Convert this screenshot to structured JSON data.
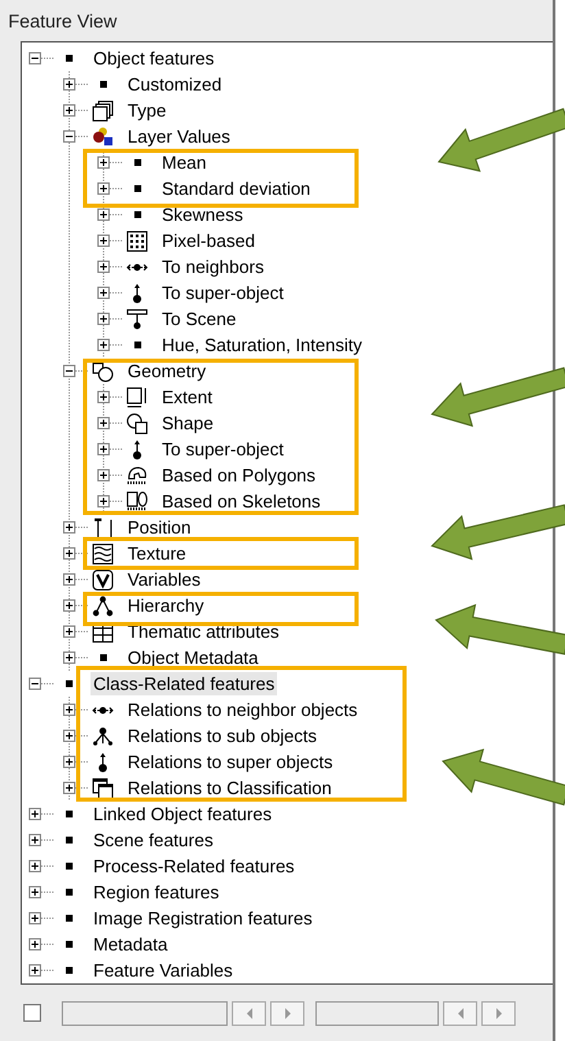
{
  "window": {
    "title": "Feature View"
  },
  "footer": {
    "checkbox": {
      "checked": false
    }
  },
  "tree": [
    {
      "label": "Object features",
      "kind": "bullet",
      "expanded": true,
      "selected": false,
      "children": [
        {
          "label": "Customized",
          "kind": "bullet",
          "expanded": false,
          "selected": false
        },
        {
          "label": "Type",
          "kind": "cubes",
          "expanded": false,
          "selected": false
        },
        {
          "label": "Layer Values",
          "kind": "layers",
          "expanded": true,
          "selected": false,
          "children": [
            {
              "label": "Mean",
              "kind": "bullet",
              "expanded": false,
              "selected": false
            },
            {
              "label": "Standard deviation",
              "kind": "bullet",
              "expanded": false,
              "selected": false
            },
            {
              "label": "Skewness",
              "kind": "bullet",
              "expanded": false,
              "selected": false
            },
            {
              "label": "Pixel-based",
              "kind": "grid",
              "expanded": false,
              "selected": false
            },
            {
              "label": "To neighbors",
              "kind": "neighbors",
              "expanded": false,
              "selected": false
            },
            {
              "label": "To super-object",
              "kind": "super",
              "expanded": false,
              "selected": false
            },
            {
              "label": "To Scene",
              "kind": "scene",
              "expanded": false,
              "selected": false
            },
            {
              "label": "Hue, Saturation, Intensity",
              "kind": "bullet",
              "expanded": false,
              "selected": false
            }
          ]
        },
        {
          "label": "Geometry",
          "kind": "geometry",
          "expanded": true,
          "selected": false,
          "children": [
            {
              "label": "Extent",
              "kind": "extent",
              "expanded": false,
              "selected": false
            },
            {
              "label": "Shape",
              "kind": "shape",
              "expanded": false,
              "selected": false
            },
            {
              "label": "To super-object",
              "kind": "super",
              "expanded": false,
              "selected": false
            },
            {
              "label": "Based on Polygons",
              "kind": "polygons",
              "expanded": false,
              "selected": false
            },
            {
              "label": "Based on Skeletons",
              "kind": "skeletons",
              "expanded": false,
              "selected": false
            }
          ]
        },
        {
          "label": "Position",
          "kind": "position",
          "expanded": false,
          "selected": false
        },
        {
          "label": "Texture",
          "kind": "texture",
          "expanded": false,
          "selected": false
        },
        {
          "label": "Variables",
          "kind": "variables",
          "expanded": false,
          "selected": false
        },
        {
          "label": "Hierarchy",
          "kind": "hierarchy",
          "expanded": false,
          "selected": false
        },
        {
          "label": "Thematic attributes",
          "kind": "thematic",
          "expanded": false,
          "selected": false
        },
        {
          "label": "Object Metadata",
          "kind": "bullet",
          "expanded": false,
          "selected": false
        }
      ]
    },
    {
      "label": "Class-Related features",
      "kind": "bullet",
      "expanded": true,
      "selected": true,
      "children": [
        {
          "label": "Relations to neighbor objects",
          "kind": "neighbors",
          "expanded": false,
          "selected": false
        },
        {
          "label": "Relations to sub objects",
          "kind": "sub",
          "expanded": false,
          "selected": false
        },
        {
          "label": "Relations to super objects",
          "kind": "super",
          "expanded": false,
          "selected": false
        },
        {
          "label": "Relations to Classification",
          "kind": "classification",
          "expanded": false,
          "selected": false
        }
      ]
    },
    {
      "label": "Linked Object features",
      "kind": "bullet",
      "expanded": false,
      "selected": false
    },
    {
      "label": "Scene features",
      "kind": "bullet",
      "expanded": false,
      "selected": false
    },
    {
      "label": "Process-Related features",
      "kind": "bullet",
      "expanded": false,
      "selected": false
    },
    {
      "label": "Region features",
      "kind": "bullet",
      "expanded": false,
      "selected": false
    },
    {
      "label": "Image Registration features",
      "kind": "bullet",
      "expanded": false,
      "selected": false
    },
    {
      "label": "Metadata",
      "kind": "bullet",
      "expanded": false,
      "selected": false
    },
    {
      "label": "Feature Variables",
      "kind": "bullet",
      "expanded": false,
      "selected": false
    }
  ]
}
